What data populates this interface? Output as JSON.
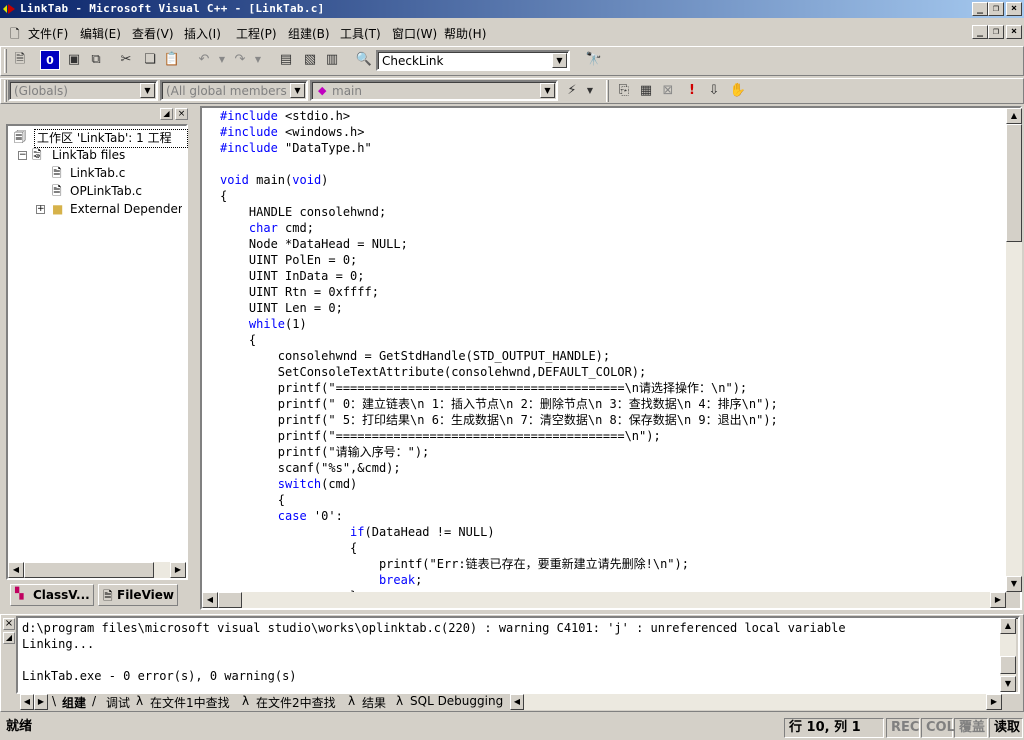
{
  "window": {
    "title": "LinkTab - Microsoft Visual C++ - [LinkTab.c]"
  },
  "menu": [
    "文件(F)",
    "编辑(E)",
    "查看(V)",
    "插入(I)",
    "工程(P)",
    "组建(B)",
    "工具(T)",
    "窗口(W)",
    "帮助(H)"
  ],
  "toolbar": {
    "find_combo_value": "CheckLink"
  },
  "wizardbar": {
    "class_combo": "(Globals)",
    "members_combo": "(All global members",
    "function_combo": "main"
  },
  "workspace": {
    "root": "工作区 'LinkTab': 1 工程",
    "project": "LinkTab files",
    "files": [
      "LinkTab.c",
      "OPLinkTab.c"
    ],
    "folder": "External Dependencies",
    "tab_classview": "ClassV...",
    "tab_fileview": "FileView"
  },
  "code": [
    [
      {
        "k": "#include",
        "t": " <stdio.h>"
      }
    ],
    [
      {
        "k": "#include",
        "t": " <windows.h>"
      }
    ],
    [
      {
        "k": "#include",
        "t": " \"DataType.h\""
      }
    ],
    [
      {
        "t": ""
      }
    ],
    [
      {
        "k": "void",
        "t": " main("
      },
      {
        "k": "void"
      },
      {
        "t": ")"
      }
    ],
    [
      {
        "t": "{"
      }
    ],
    [
      {
        "t": "    HANDLE consolehwnd;"
      }
    ],
    [
      {
        "t": "    "
      },
      {
        "k": "char"
      },
      {
        "t": " cmd;"
      }
    ],
    [
      {
        "t": "    Node *DataHead = NULL;"
      }
    ],
    [
      {
        "t": "    UINT PolEn = 0;"
      }
    ],
    [
      {
        "t": "    UINT InData = 0;"
      }
    ],
    [
      {
        "t": "    UINT Rtn = 0xffff;"
      }
    ],
    [
      {
        "t": "    UINT Len = 0;"
      }
    ],
    [
      {
        "t": "    "
      },
      {
        "k": "while"
      },
      {
        "t": "(1)"
      }
    ],
    [
      {
        "t": "    {"
      }
    ],
    [
      {
        "t": "        consolehwnd = GetStdHandle(STD_OUTPUT_HANDLE);"
      }
    ],
    [
      {
        "t": "        SetConsoleTextAttribute(consolehwnd,DEFAULT_COLOR);"
      }
    ],
    [
      {
        "t": "        printf(\"========================================\\n请选择操作：\\n\");"
      }
    ],
    [
      {
        "t": "        printf(\" 0：建立链表\\n 1：插入节点\\n 2：删除节点\\n 3：查找数据\\n 4：排序\\n\");"
      }
    ],
    [
      {
        "t": "        printf(\" 5：打印结果\\n 6：生成数据\\n 7：清空数据\\n 8：保存数据\\n 9：退出\\n\");"
      }
    ],
    [
      {
        "t": "        printf(\"========================================\\n\");"
      }
    ],
    [
      {
        "t": "        printf(\"请输入序号：\");"
      }
    ],
    [
      {
        "t": "        scanf(\"%s\",&cmd);"
      }
    ],
    [
      {
        "t": "        "
      },
      {
        "k": "switch"
      },
      {
        "t": "(cmd)"
      }
    ],
    [
      {
        "t": "        {"
      }
    ],
    [
      {
        "t": "        "
      },
      {
        "k": "case"
      },
      {
        "t": " '0':"
      }
    ],
    [
      {
        "t": "                  "
      },
      {
        "k": "if"
      },
      {
        "t": "(DataHead != NULL)"
      }
    ],
    [
      {
        "t": "                  {"
      }
    ],
    [
      {
        "t": "                      printf(\"Err:链表已存在，要重新建立请先删除!\\n\");"
      }
    ],
    [
      {
        "t": "                      "
      },
      {
        "k": "break"
      },
      {
        "t": ";"
      }
    ],
    [
      {
        "t": "                  }"
      }
    ]
  ],
  "output": {
    "lines": [
      "d:\\program files\\microsoft visual studio\\works\\oplinktab.c(220) : warning C4101: 'j' : unreferenced local variable",
      "Linking...",
      "",
      "LinkTab.exe - 0 error(s), 0 warning(s)"
    ],
    "tabs": [
      "组建",
      "调试",
      "在文件1中查找",
      "在文件2中查找",
      "结果",
      "SQL Debugging"
    ]
  },
  "status": {
    "message": "就绪",
    "position": "行 10, 列 1",
    "rec": "REC",
    "col": "COL",
    "ovr": "覆盖",
    "read": "读取"
  }
}
